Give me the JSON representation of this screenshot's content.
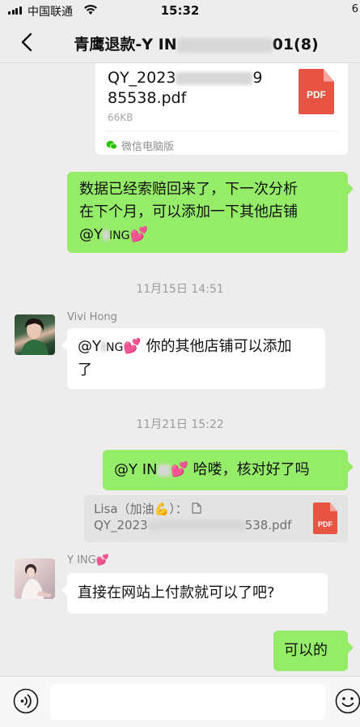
{
  "status_bar": {
    "carrier": "中国联通",
    "time": "15:32",
    "battery": "6"
  },
  "header": {
    "title_prefix": "青鹰退款-Y IN",
    "title_suffix": "01(8)"
  },
  "messages": {
    "file1": {
      "name_line1": "QY_2023",
      "name_line1_end": "9",
      "name_line2": "85538.pdf",
      "size": "66KB",
      "source": "微信电脑版",
      "icon_label": "PDF"
    },
    "msg1": {
      "text_line1": "数据已经索赔回来了，下一次分析",
      "text_line2": "在下个月，可以添加一下其他店铺",
      "mention": "@Y",
      "mention_mid": "ING",
      "emoji": "💕"
    },
    "time1": "11月15日 14:51",
    "msg2": {
      "sender": "Vivi Hong",
      "mention": "@Y",
      "mention_mid": "NG",
      "emoji": "💕",
      "text_a": "你的其他店铺可以添加",
      "text_b": "了"
    },
    "time2": "11月21日 15:22",
    "msg3": {
      "mention": "@Y IN",
      "emoji": "💕",
      "text": "哈喽，核对好了吗"
    },
    "quote": {
      "author": "Lisa（加油",
      "author_emoji": "💪",
      "author_end": "）：",
      "file_prefix": "QY_2023",
      "file_suffix": "538.pdf",
      "icon_label": "PDF"
    },
    "msg4": {
      "sender": "Y ING",
      "sender_emoji": "💕",
      "text": "直接在网站上付款就可以了吧?"
    },
    "msg5": {
      "text": "可以的"
    }
  },
  "input_bar": {
    "placeholder": ""
  },
  "colors": {
    "bubble_green": "#95ec69",
    "bubble_white": "#ffffff",
    "background": "#ededed",
    "pdf_red": "#e85444"
  },
  "icons": [
    "signal-icon",
    "wifi-icon",
    "back-icon",
    "pdf-icon",
    "wechat-pc-icon",
    "doc-icon",
    "voice-icon",
    "emoji-icon"
  ]
}
